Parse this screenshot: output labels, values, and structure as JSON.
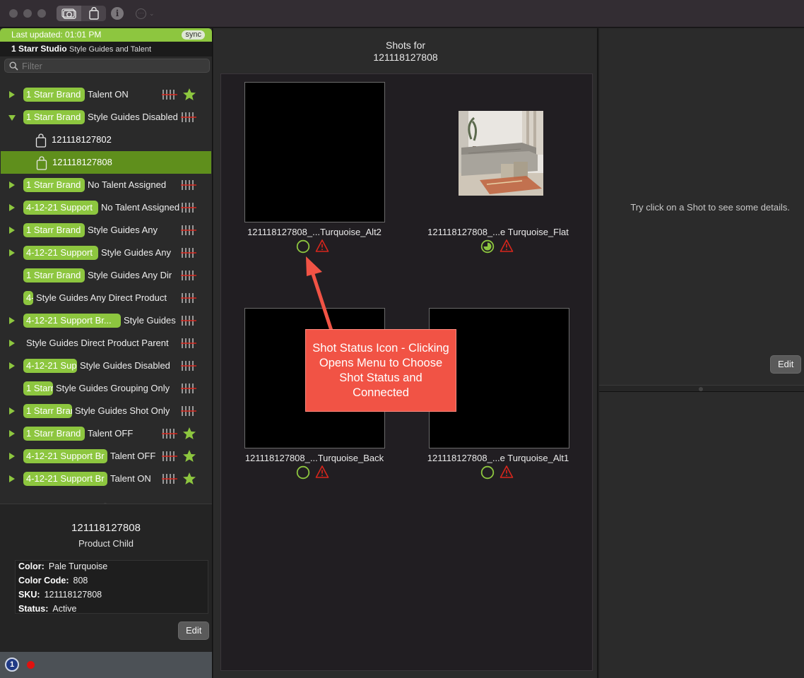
{
  "toolbar": {
    "segments": [
      "camera-icon",
      "bag-icon"
    ],
    "info_icon": "info-icon",
    "info_glyph": "i",
    "more_icon": "ellipsis-circle-icon",
    "more_glyph": "···",
    "chevron_glyph": "⌄"
  },
  "sidebar": {
    "last_updated": "Last updated: 01:01 PM",
    "sync_label": "sync",
    "studio_name": "1 Starr Studio",
    "studio_sub": "Style Guides and Talent",
    "filter_placeholder": "Filter",
    "tree": [
      {
        "badge": "1 Starr Brand",
        "label": "Talent ON",
        "star": true
      },
      {
        "badge": "1 Starr Brand",
        "label": "Style Guides Disabled",
        "star": false,
        "expanded": true
      },
      {
        "sku": "121118127802"
      },
      {
        "sku": "121118127808",
        "selected": true
      },
      {
        "badge": "1 Starr Brand",
        "label": "No Talent Assigned",
        "star": false
      },
      {
        "badge": "4-12-21 Support",
        "label": "No Talent Assigned",
        "star": false
      },
      {
        "badge": "1 Starr Brand",
        "label": "Style Guides Any",
        "star": false
      },
      {
        "badge": "4-12-21 Support",
        "label": "Style Guides Any",
        "star": false
      },
      {
        "badge": "1 Starr Brand",
        "label": "Style Guides Any Dir",
        "star": false
      },
      {
        "badge": "4-",
        "label": "Style Guides Any Direct Product",
        "star": false
      },
      {
        "badge": "4-12-21 Support Br...",
        "label": "Style Guides",
        "star": false
      },
      {
        "badge": "",
        "label": "Style Guides Direct Product Parent",
        "star": false
      },
      {
        "badge": "4-12-21 Sup",
        "label": "Style Guides Disabled",
        "star": false
      },
      {
        "badge": "1 Starr",
        "label": "Style Guides Grouping Only",
        "star": false
      },
      {
        "badge": "1 Starr Bran",
        "label": "Style Guides Shot Only",
        "star": false
      },
      {
        "badge": "1 Starr Brand",
        "label": "Talent OFF",
        "star": true
      },
      {
        "badge": "4-12-21 Support Br",
        "label": "Talent OFF",
        "star": true
      },
      {
        "badge": "4-12-21 Support Br",
        "label": "Talent ON",
        "star": true
      }
    ],
    "details": {
      "title": "121118127808",
      "subtitle": "Product Child",
      "fields": [
        {
          "key": "Color:",
          "value": "Pale Turquoise"
        },
        {
          "key": "Color Code:",
          "value": "808"
        },
        {
          "key": "SKU:",
          "value": "121118127808"
        },
        {
          "key": "Status:",
          "value": "Active"
        }
      ],
      "edit_label": "Edit"
    },
    "status_icon_text": "1"
  },
  "shots": {
    "title_line1": "Shots for",
    "title_line2": "121118127808",
    "items": [
      {
        "caption": "121118127808_...Turquoise_Alt2",
        "status": "empty-circle-icon",
        "warning": "warning-triangle-icon"
      },
      {
        "caption": "121118127808_...e Turquoise_Flat",
        "status": "partial-circle-icon",
        "warning": "warning-triangle-icon"
      },
      {
        "caption": "121118127808_...Turquoise_Back",
        "status": "empty-circle-icon",
        "warning": "warning-triangle-icon"
      },
      {
        "caption": "121118127808_...e Turquoise_Alt1",
        "status": "empty-circle-icon",
        "warning": "warning-triangle-icon"
      }
    ]
  },
  "callout": {
    "text": "Shot Status Icon - Clicking Opens Menu to Choose Shot Status and Connected"
  },
  "right_panel": {
    "hint": "Try click on a Shot to see some details.",
    "edit_label": "Edit"
  },
  "colors": {
    "accent_green": "#8dc63f",
    "selected_row": "#5f8f1c",
    "callout_red": "#f15345",
    "warning_red": "#d8261c"
  }
}
